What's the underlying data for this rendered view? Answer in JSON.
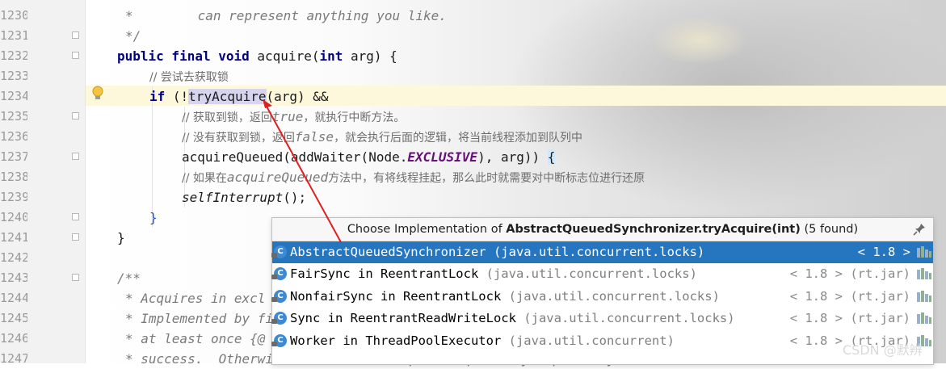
{
  "gutter": {
    "line_numbers": [
      "1230",
      "1231",
      "1232",
      "1233",
      "1234",
      "1235",
      "1236",
      "1237",
      "1238",
      "1239",
      "1240",
      "1241",
      "1242",
      "1243",
      "1244",
      "1245",
      "1246",
      "1247"
    ]
  },
  "code": {
    "l1230_star": "*",
    "l1230_text": "can represent anything you like.",
    "l1231": "*/",
    "l1232_kw": "public final void",
    "l1232_rest": " acquire(",
    "l1232_int": "int",
    "l1232_end": " arg) {",
    "l1233": "// 尝试去获取锁",
    "l1234_if": "if",
    "l1234_a": " (!",
    "l1234_method": "tryAcquire",
    "l1234_b": "(arg) &&",
    "l1235_a": "// 获取到锁，返回",
    "l1235_b": "true",
    "l1235_c": "，就执行中断方法。",
    "l1236_a": "// 没有获取到锁，返回",
    "l1236_b": "false",
    "l1236_c": "，就会执行后面的逻辑，将当前线程添加到队列中",
    "l1237_a": "acquireQueued(addWaiter(Node.",
    "l1237_const": "EXCLUSIVE",
    "l1237_b": "), arg)) ",
    "l1237_brace": "{",
    "l1238_a": "// 如果在",
    "l1238_b": "acquireQueued",
    "l1238_c": "方法中，有将线程挂起，那么此时就需要对中断标志位进行还原",
    "l1239_m": "selfInterrupt",
    "l1239_e": "();",
    "l1240": "}",
    "l1241": "}",
    "l1243": "/**",
    "l1244": "* Acquires in excl",
    "l1245": "* Implemented by fi",
    "l1246": "* at least once {@",
    "l1247": "* success.  Otherwise the thread is queued, possibly repeatedly"
  },
  "popup": {
    "title_prefix": "Choose Implementation of ",
    "title_bold": "AbstractQueuedSynchronizer.tryAcquire(int)",
    "title_suffix": " (5 found)",
    "items": [
      {
        "name": "AbstractQueuedSynchronizer",
        "pkg": " (java.util.concurrent.locks)",
        "ver": "< 1.8 >"
      },
      {
        "name": "FairSync in ReentrantLock",
        "pkg": " (java.util.concurrent.locks)",
        "ver": "< 1.8 > (rt.jar)"
      },
      {
        "name": "NonfairSync in ReentrantLock",
        "pkg": " (java.util.concurrent.locks)",
        "ver": "< 1.8 > (rt.jar)"
      },
      {
        "name": "Sync in ReentrantReadWriteLock",
        "pkg": " (java.util.concurrent.locks)",
        "ver": "< 1.8 > (rt.jar)"
      },
      {
        "name": "Worker in ThreadPoolExecutor",
        "pkg": " (java.util.concurrent)",
        "ver": "< 1.8 > (rt.jar)"
      }
    ],
    "class_icon_letter": "C"
  },
  "watermark": "CSDN @默辨",
  "colors": {
    "selection": "#2675bf",
    "keyword": "#000080",
    "arrow": "#e02020"
  }
}
